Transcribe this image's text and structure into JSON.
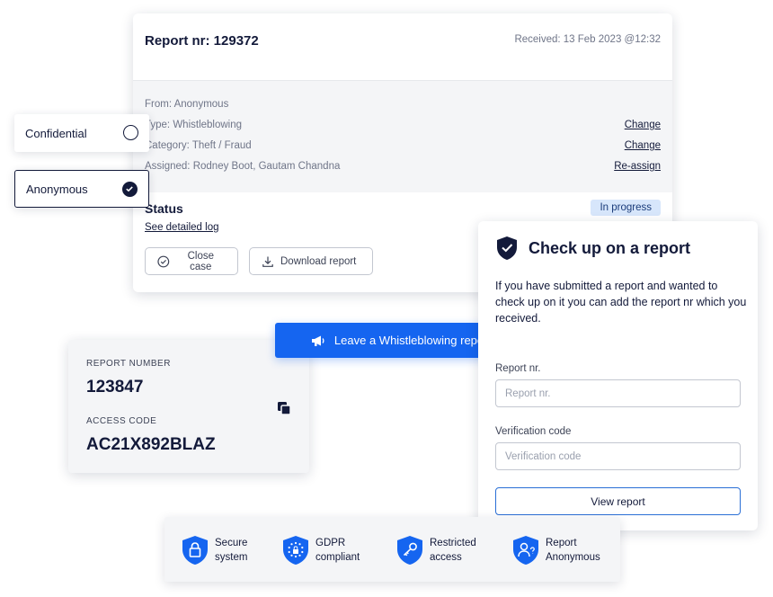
{
  "report": {
    "title": "Report nr: 129372",
    "received": "Received: 13 Feb 2023 @12:32",
    "details": [
      {
        "label": "From: Anonymous",
        "action": ""
      },
      {
        "label": "Type: Whistleblowing",
        "action": "Change"
      },
      {
        "label": "Category: Theft / Fraud",
        "action": "Change"
      },
      {
        "label": "Assigned: Rodney Boot, Gautam Chandna",
        "action": "Re-assign"
      }
    ],
    "status_label": "Status",
    "status_badge": "In progress",
    "log_link": "See detailed log",
    "close_btn": "Close case",
    "download_btn": "Download report"
  },
  "options": {
    "confidential": "Confidential",
    "anonymous": "Anonymous",
    "selected": "anonymous"
  },
  "codes": {
    "report_number_label": "REPORT NUMBER",
    "report_number": "123847",
    "access_code_label": "ACCESS CODE",
    "access_code": "AC21X892BLAZ"
  },
  "cta": {
    "label": "Leave a Whistleblowing report"
  },
  "check": {
    "title": "Check up on a report",
    "description": "If you have submitted a report and wanted to check up on it you can add the report nr which you received.",
    "report_label": "Report nr.",
    "report_placeholder": "Report nr.",
    "verification_label": "Verification code",
    "verification_placeholder": "Verification code",
    "view_btn": "View report"
  },
  "features": [
    {
      "line1": "Secure",
      "line2": "system",
      "icon": "lock-shield-icon"
    },
    {
      "line1": "GDPR",
      "line2": "compliant",
      "icon": "eu-stars-shield-icon"
    },
    {
      "line1": "Restricted",
      "line2": "access",
      "icon": "key-shield-icon"
    },
    {
      "line1": "Report",
      "line2": "Anonymous",
      "icon": "user-shield-icon"
    }
  ],
  "colors": {
    "primary": "#1565f0",
    "navy": "#131a3a",
    "badge_bg": "#d7e6fb",
    "shield": "#1565f0"
  }
}
